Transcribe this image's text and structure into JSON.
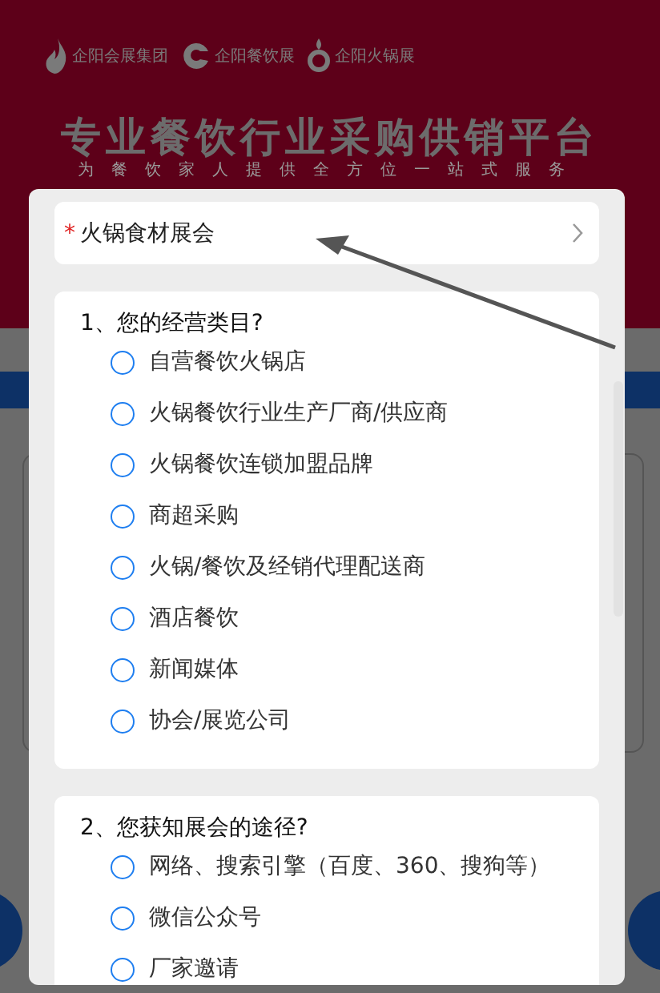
{
  "background": {
    "logos": [
      {
        "kind": "flame",
        "name": "企阳会展集团"
      },
      {
        "kind": "crescent",
        "name": "企阳餐饮展"
      },
      {
        "kind": "ring",
        "name": "企阳火锅展"
      }
    ],
    "title": "专业餐饮行业采购供销平台",
    "subtitle": "为餐饮家人提供全方位一站式服务"
  },
  "form": {
    "exhibition": {
      "required_mark": "*",
      "value": "火锅食材展会"
    },
    "questions": [
      {
        "title": "1、您的经营类目?",
        "options": [
          {
            "label": "自营餐饮火锅店",
            "selected": false
          },
          {
            "label": "火锅餐饮行业生产厂商/供应商",
            "selected": false
          },
          {
            "label": "火锅餐饮连锁加盟品牌",
            "selected": false
          },
          {
            "label": "商超采购",
            "selected": false
          },
          {
            "label": "火锅/餐饮及经销代理配送商",
            "selected": false
          },
          {
            "label": "酒店餐饮",
            "selected": false
          },
          {
            "label": "新闻媒体",
            "selected": false
          },
          {
            "label": "协会/展览公司",
            "selected": false
          }
        ]
      },
      {
        "title": "2、您获知展会的途径?",
        "options": [
          {
            "label": "网络、搜索引擎（百度、360、搜狗等）",
            "selected": false
          },
          {
            "label": "微信公众号",
            "selected": false
          },
          {
            "label": "厂家邀请",
            "selected": false
          }
        ]
      }
    ]
  }
}
